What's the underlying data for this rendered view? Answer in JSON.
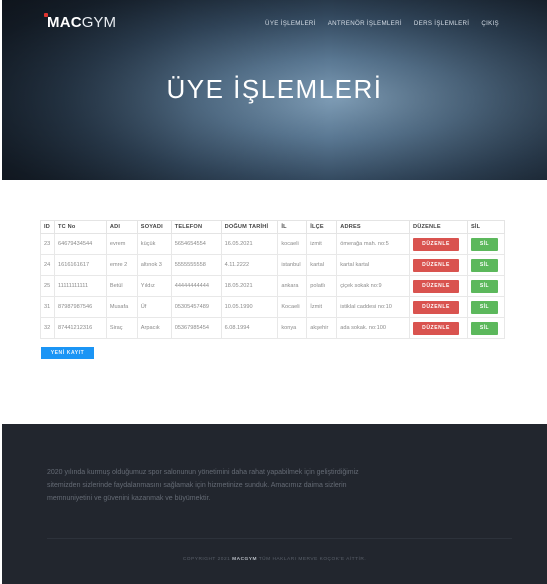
{
  "logo": {
    "bold": "MAC",
    "light": "GYM"
  },
  "nav": [
    "ÜYE İŞLEMLERİ",
    "ANTRENÖR İŞLEMLERİ",
    "DERS İŞLEMLERİ",
    "ÇIKIŞ"
  ],
  "hero": {
    "title": "ÜYE İŞLEMLERİ"
  },
  "table": {
    "headers": [
      "ID",
      "TC No",
      "ADI",
      "SOYADI",
      "TELEFON",
      "DOĞUM TARİHİ",
      "İL",
      "İLÇE",
      "ADRES",
      "DÜZENLE",
      "SİL"
    ],
    "rows": [
      [
        "23",
        "64679434544",
        "evrem",
        "küçük",
        "5654654554",
        "16.05.2021",
        "kocaeli",
        "izmit",
        "ömerağa mah. no:5"
      ],
      [
        "24",
        "1616161617",
        "emre 2",
        "altınok 3",
        "5555555558",
        "4.11.2222",
        "istanbul",
        "kartal",
        "kartal kartal"
      ],
      [
        "25",
        "11111111111",
        "Betül",
        "Yıldız",
        "44444444444",
        "18.05.2021",
        "ankara",
        "polatlı",
        "çiçek sokak no:9"
      ],
      [
        "31",
        "87987987546",
        "Musafa",
        "Üf",
        "05305457489",
        "10.05.1990",
        "Kocaeli",
        "İzmit",
        "istiklal caddesi no:10"
      ],
      [
        "32",
        "87441212316",
        "Siraç",
        "Arpacık",
        "05367985454",
        "6.08.1994",
        "konya",
        "akşehir",
        "ada sokak. no:100"
      ]
    ],
    "edit_label": "DÜZENLE",
    "delete_label": "SİL"
  },
  "new_record_label": "YENİ KAYIT",
  "footer": {
    "text": "2020 yılında kurmuş olduğumuz spor salonunun yönetimini daha rahat yapabilmek için geliştirdiğimiz sitemizden sizlerinde faydalanmasını sağlamak için hizmetinize sunduk. Amacımız daima sizlerin memnuniyetini ve güvenini kazanmak ve büyümektir.",
    "copyright_prefix": "COPYRIGHT 2021",
    "copyright_brand": "MACGYM",
    "copyright_suffix": "TÜM HAKLARI MERVE KOÇOK'E AİTTİR."
  },
  "colors": {
    "edit_button": "#d9534f",
    "delete_button": "#5cb85c",
    "new_button": "#1b95f5",
    "footer_bg": "#22262e",
    "logo_accent": "#e0342f"
  }
}
